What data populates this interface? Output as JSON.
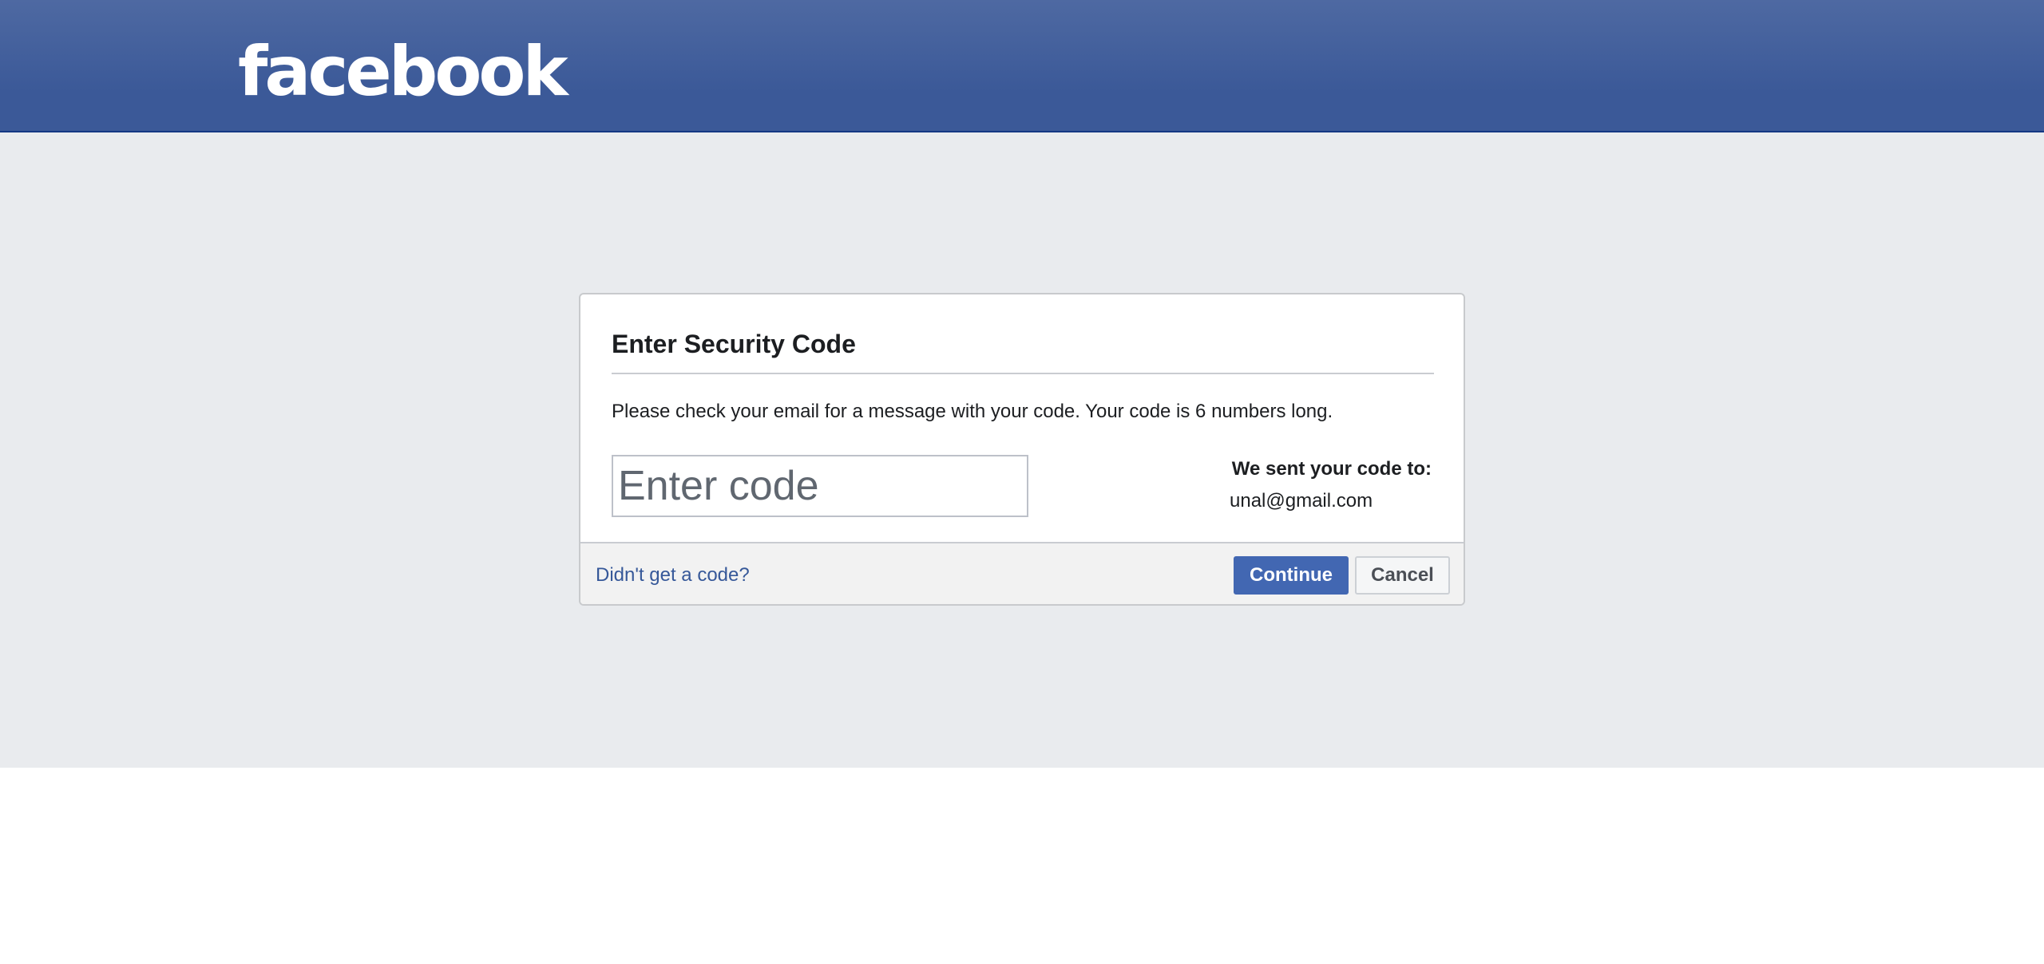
{
  "header": {
    "logo_text": "facebook",
    "colors": {
      "header_bg": "#3b5998",
      "page_bg": "#e9ebee"
    }
  },
  "dialog": {
    "title": "Enter Security Code",
    "instructions": "Please check your email for a message with your code. Your code is 6 numbers long.",
    "code_input": {
      "placeholder": "Enter code",
      "value": ""
    },
    "sent_to_label": "We sent your code to:",
    "sent_to_email": "unal@gmail.com",
    "footer": {
      "no_code_link": "Didn't get a code?",
      "continue_label": "Continue",
      "cancel_label": "Cancel"
    },
    "colors": {
      "primary_button": "#4267b2",
      "link": "#365899"
    }
  }
}
